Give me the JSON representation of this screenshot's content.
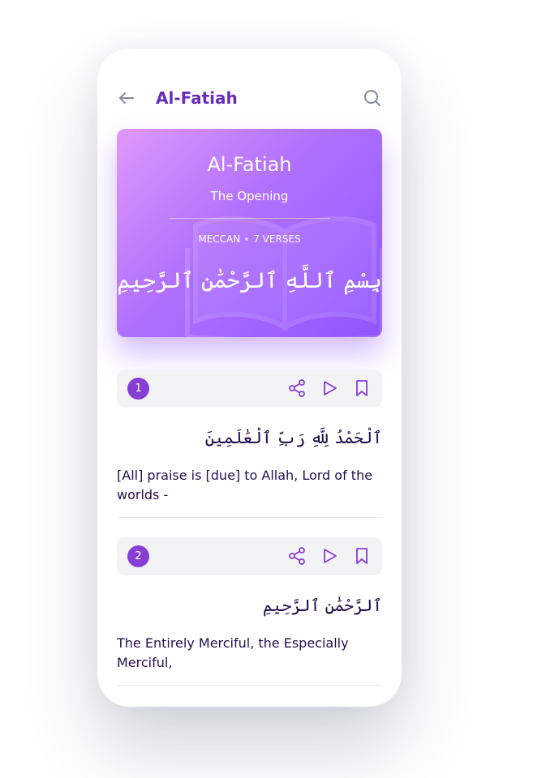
{
  "header": {
    "back_icon": "arrow-left-icon",
    "title": "Al-Fatiah",
    "search_icon": "search-icon"
  },
  "banner": {
    "title": "Al-Fatiah",
    "subtitle": "The Opening",
    "place": "MECCAN",
    "verses": "7 VERSES",
    "bismillah": "بِسْمِ ٱللَّهِ ٱلرَّحْمَٰنِ ٱلرَّحِيمِ"
  },
  "verses": [
    {
      "number": "1",
      "arabic": "ٱلْحَمْدُ لِلَّهِ رَبِّ ٱلْعَٰلَمِينَ",
      "translation": "[All] praise is [due] to Allah, Lord of the worlds -"
    },
    {
      "number": "2",
      "arabic": "ٱلرَّحْمَٰنِ ٱلرَّحِيمِ",
      "translation": "The Entirely Merciful, the Especially Merciful,"
    }
  ],
  "colors": {
    "accent": "#672CBC",
    "icon": "#863ED5",
    "text": "#240F4F",
    "bar": "#F3F3F5"
  }
}
